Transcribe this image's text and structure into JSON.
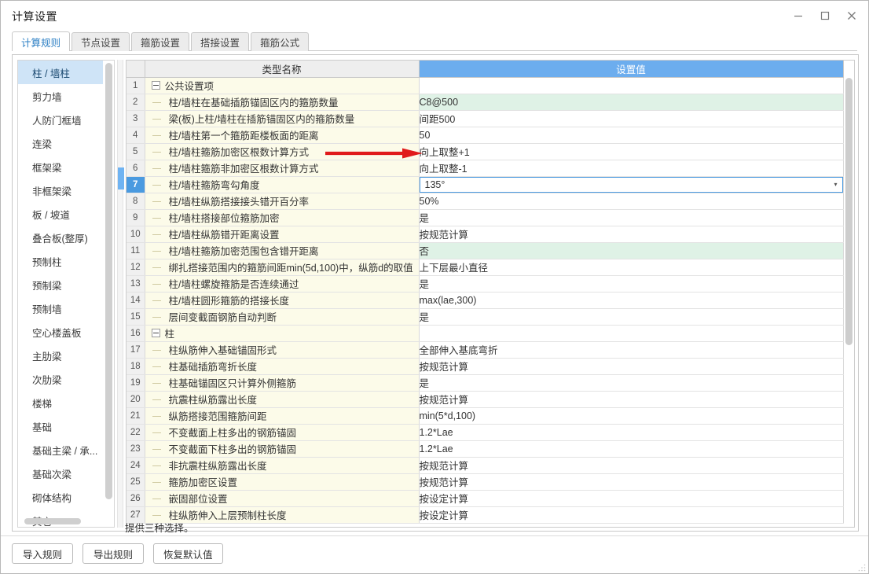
{
  "window": {
    "title": "计算设置",
    "controls": {
      "minimize": "minimize-icon",
      "maximize": "maximize-icon",
      "close": "close-icon"
    }
  },
  "tabs": [
    {
      "label": "计算规则",
      "active": true
    },
    {
      "label": "节点设置",
      "active": false
    },
    {
      "label": "箍筋设置",
      "active": false
    },
    {
      "label": "搭接设置",
      "active": false
    },
    {
      "label": "箍筋公式",
      "active": false
    }
  ],
  "sidebar": {
    "items": [
      {
        "label": "柱 / 墙柱",
        "active": true
      },
      {
        "label": "剪力墙",
        "active": false
      },
      {
        "label": "人防门框墙",
        "active": false
      },
      {
        "label": "连梁",
        "active": false
      },
      {
        "label": "框架梁",
        "active": false
      },
      {
        "label": "非框架梁",
        "active": false
      },
      {
        "label": "板 / 坡道",
        "active": false
      },
      {
        "label": "叠合板(整厚)",
        "active": false
      },
      {
        "label": "预制柱",
        "active": false
      },
      {
        "label": "预制梁",
        "active": false
      },
      {
        "label": "预制墙",
        "active": false
      },
      {
        "label": "空心楼盖板",
        "active": false
      },
      {
        "label": "主肋梁",
        "active": false
      },
      {
        "label": "次肋梁",
        "active": false
      },
      {
        "label": "楼梯",
        "active": false
      },
      {
        "label": "基础",
        "active": false
      },
      {
        "label": "基础主梁 / 承...",
        "active": false
      },
      {
        "label": "基础次梁",
        "active": false
      },
      {
        "label": "砌体结构",
        "active": false
      },
      {
        "label": "其它",
        "active": false
      }
    ]
  },
  "table": {
    "headers": {
      "row_number": "",
      "type_name": "类型名称",
      "setting_value": "设置值"
    },
    "rows": [
      {
        "n": "1",
        "kind": "group",
        "name": "公共设置项",
        "value": "",
        "state": "normal"
      },
      {
        "n": "2",
        "kind": "item",
        "name": "柱/墙柱在基础插筋锚固区内的箍筋数量",
        "value": "C8@500",
        "state": "modified"
      },
      {
        "n": "3",
        "kind": "item",
        "name": "梁(板)上柱/墙柱在插筋锚固区内的箍筋数量",
        "value": "间距500",
        "state": "normal"
      },
      {
        "n": "4",
        "kind": "item",
        "name": "柱/墙柱第一个箍筋距楼板面的距离",
        "value": "50",
        "state": "normal"
      },
      {
        "n": "5",
        "kind": "item",
        "name": "柱/墙柱箍筋加密区根数计算方式",
        "value": "向上取整+1",
        "state": "normal"
      },
      {
        "n": "6",
        "kind": "item",
        "name": "柱/墙柱箍筋非加密区根数计算方式",
        "value": "向上取整-1",
        "state": "normal"
      },
      {
        "n": "7",
        "kind": "item",
        "name": "柱/墙柱箍筋弯勾角度",
        "value": "135°",
        "state": "selected"
      },
      {
        "n": "8",
        "kind": "item",
        "name": "柱/墙柱纵筋搭接接头错开百分率",
        "value": "50%",
        "state": "normal"
      },
      {
        "n": "9",
        "kind": "item",
        "name": "柱/墙柱搭接部位箍筋加密",
        "value": "是",
        "state": "normal"
      },
      {
        "n": "10",
        "kind": "item",
        "name": "柱/墙柱纵筋错开距离设置",
        "value": "按规范计算",
        "state": "normal"
      },
      {
        "n": "11",
        "kind": "item",
        "name": "柱/墙柱箍筋加密范围包含错开距离",
        "value": "否",
        "state": "modified"
      },
      {
        "n": "12",
        "kind": "item",
        "name": "绑扎搭接范围内的箍筋间距min(5d,100)中，纵筋d的取值",
        "value": "上下层最小直径",
        "state": "normal"
      },
      {
        "n": "13",
        "kind": "item",
        "name": "柱/墙柱螺旋箍筋是否连续通过",
        "value": "是",
        "state": "normal"
      },
      {
        "n": "14",
        "kind": "item",
        "name": "柱/墙柱圆形箍筋的搭接长度",
        "value": "max(lae,300)",
        "state": "normal"
      },
      {
        "n": "15",
        "kind": "item",
        "name": "层间变截面钢筋自动判断",
        "value": "是",
        "state": "normal"
      },
      {
        "n": "16",
        "kind": "group",
        "name": "柱",
        "value": "",
        "state": "normal"
      },
      {
        "n": "17",
        "kind": "item",
        "name": "柱纵筋伸入基础锚固形式",
        "value": "全部伸入基底弯折",
        "state": "normal"
      },
      {
        "n": "18",
        "kind": "item",
        "name": "柱基础插筋弯折长度",
        "value": "按规范计算",
        "state": "normal"
      },
      {
        "n": "19",
        "kind": "item",
        "name": "柱基础锚固区只计算外侧箍筋",
        "value": "是",
        "state": "normal"
      },
      {
        "n": "20",
        "kind": "item",
        "name": "抗震柱纵筋露出长度",
        "value": "按规范计算",
        "state": "normal"
      },
      {
        "n": "21",
        "kind": "item",
        "name": "纵筋搭接范围箍筋间距",
        "value": "min(5*d,100)",
        "state": "normal"
      },
      {
        "n": "22",
        "kind": "item",
        "name": "不变截面上柱多出的钢筋锚固",
        "value": "1.2*Lae",
        "state": "normal"
      },
      {
        "n": "23",
        "kind": "item",
        "name": "不变截面下柱多出的钢筋锚固",
        "value": "1.2*Lae",
        "state": "normal"
      },
      {
        "n": "24",
        "kind": "item",
        "name": "非抗震柱纵筋露出长度",
        "value": "按规范计算",
        "state": "normal"
      },
      {
        "n": "25",
        "kind": "item",
        "name": "箍筋加密区设置",
        "value": "按规范计算",
        "state": "normal"
      },
      {
        "n": "26",
        "kind": "item",
        "name": "嵌固部位设置",
        "value": "按设定计算",
        "state": "normal"
      },
      {
        "n": "27",
        "kind": "item",
        "name": "柱纵筋伸入上层预制柱长度",
        "value": "按设定计算",
        "state": "normal"
      }
    ],
    "expander_symbol": "−"
  },
  "status": {
    "hint": "提供三种选择。"
  },
  "footer": {
    "buttons": [
      {
        "label": "导入规则"
      },
      {
        "label": "导出规则"
      },
      {
        "label": "恢复默认值"
      }
    ]
  },
  "colors": {
    "header_accent": "#6cadee",
    "selection": "#4a9ae0",
    "sidebar_selection": "#cfe4f7",
    "modified_cell": "#dff2e6",
    "name_column": "#fcfbe9",
    "annotation_arrow": "#e01b1b",
    "active_tab_text": "#2c7fc4"
  }
}
